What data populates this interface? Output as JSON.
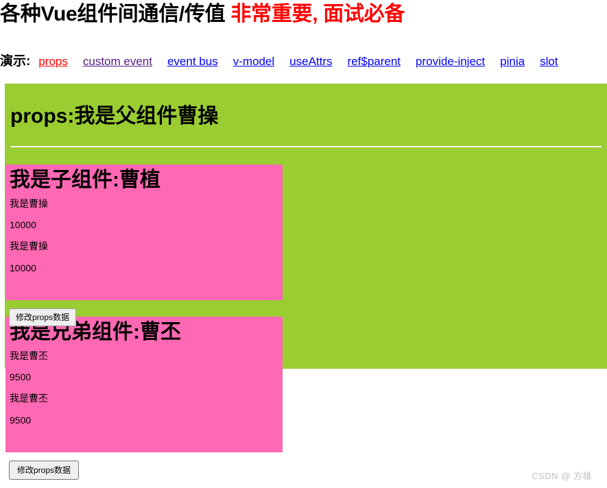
{
  "colors": {
    "parent_background": "#9acd32",
    "child_background": "#ff69b4",
    "title_accent": "#ff0000",
    "link_default": "#0000ee",
    "link_active": "#ff0000",
    "link_visited": "#551a8b",
    "watermark": "#c2c2c2"
  },
  "header": {
    "title_main": "各种Vue组件间通信/传值",
    "title_accent": "非常重要, 面试必备"
  },
  "demo": {
    "label": "演示:",
    "links": [
      {
        "label": "props",
        "state": "active"
      },
      {
        "label": "custom event",
        "state": "visited"
      },
      {
        "label": "event bus",
        "state": "default"
      },
      {
        "label": "v-model",
        "state": "default"
      },
      {
        "label": "useAttrs",
        "state": "default"
      },
      {
        "label": "ref$parent",
        "state": "default"
      },
      {
        "label": "provide-inject",
        "state": "default"
      },
      {
        "label": "pinia",
        "state": "default"
      },
      {
        "label": "slot",
        "state": "default"
      }
    ]
  },
  "parent": {
    "title": "props:我是父组件曹操"
  },
  "child": {
    "title": "我是子组件:曹植",
    "lines": [
      "我是曹操",
      "10000",
      "我是曹操",
      "10000"
    ],
    "button_label": "修改props数据"
  },
  "sibling": {
    "title": "我是兄弟组件:曹丕",
    "lines": [
      "我是曹丕",
      "9500",
      "我是曹丕",
      "9500"
    ],
    "button_label": "修改props数据"
  },
  "watermark": {
    "text": "CSDN @  方雄"
  }
}
